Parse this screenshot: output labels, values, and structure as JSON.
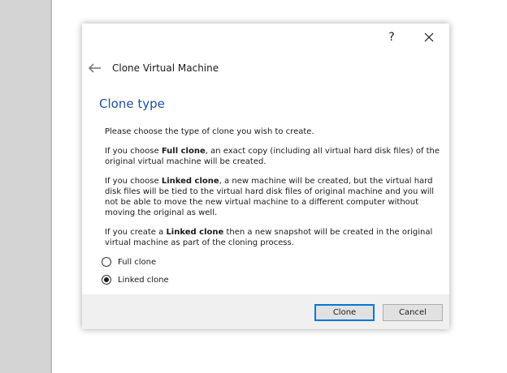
{
  "dialog": {
    "help_label": "?",
    "icons": {
      "back": "back-arrow-icon",
      "close": "close-icon"
    },
    "wizard_title": "Clone Virtual Machine",
    "page_title": "Clone type",
    "paragraphs": [
      {
        "text": "Please choose the type of clone you wish to create."
      },
      {
        "before": "If you choose ",
        "bold": "Full clone",
        "after": ", an exact copy (including all virtual hard disk files) of the original virtual machine will be created."
      },
      {
        "before": "If you choose ",
        "bold": "Linked clone",
        "after": ", a new machine will be created, but the virtual hard disk files will be tied to the virtual hard disk files of original machine and you will not be able to move the new virtual machine to a different computer without moving the original as well."
      },
      {
        "before": "If you create a ",
        "bold": "Linked clone",
        "after": " then a new snapshot will be created in the original virtual machine as part of the cloning process."
      }
    ],
    "options": [
      {
        "label": "Full clone",
        "selected": false
      },
      {
        "label": "Linked clone",
        "selected": true
      }
    ],
    "buttons": {
      "ok": "Clone",
      "cancel": "Cancel"
    },
    "colors": {
      "title": "#1d4f9e",
      "focus_border": "#0078d7",
      "footer": "#f0f0f0"
    }
  }
}
